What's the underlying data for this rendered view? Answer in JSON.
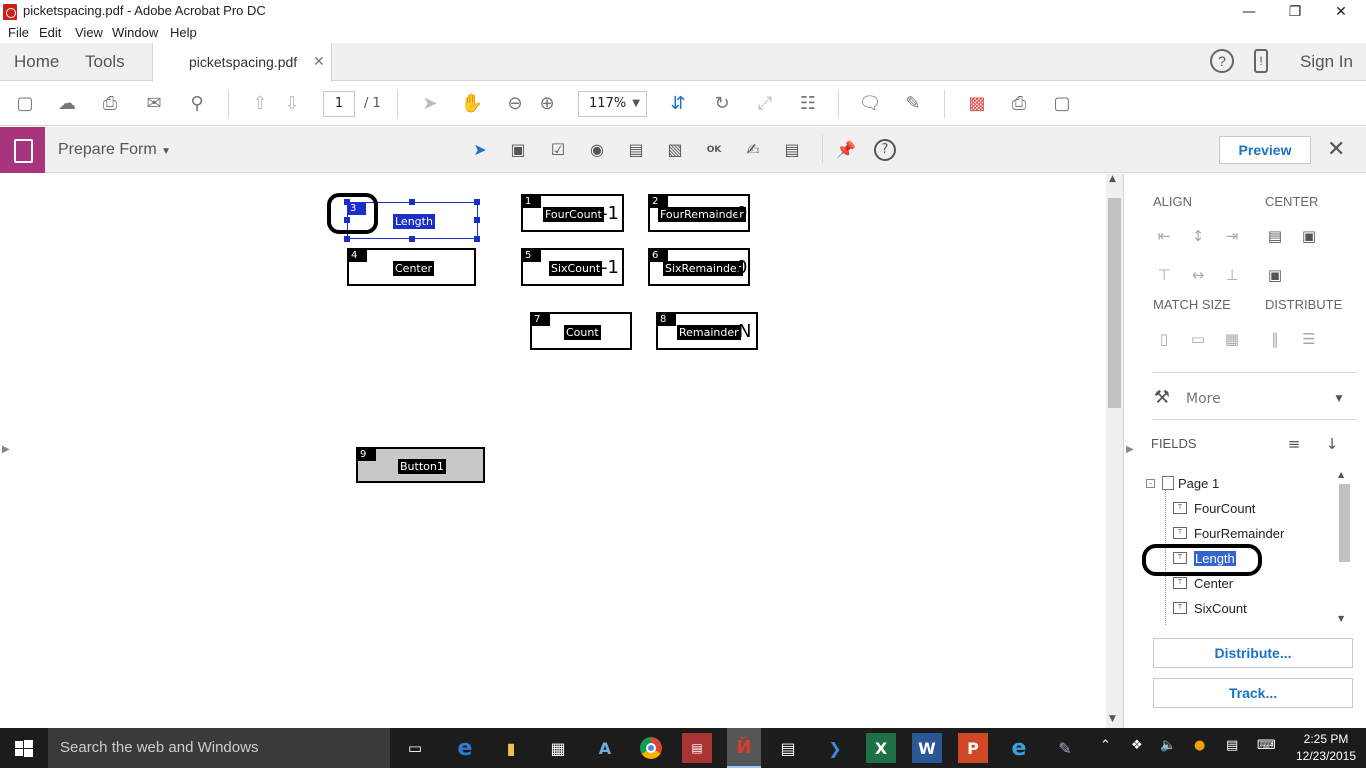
{
  "window": {
    "title": "picketspacing.pdf - Adobe Acrobat Pro DC"
  },
  "menu": {
    "file": "File",
    "edit": "Edit",
    "view": "View",
    "window": "Window",
    "help": "Help"
  },
  "tabs": {
    "home": "Home",
    "tools": "Tools",
    "document": "picketspacing.pdf",
    "sign_in": "Sign In"
  },
  "toolbar": {
    "page_current": "1",
    "page_total": "/ 1",
    "zoom": "117%"
  },
  "prepare_form": {
    "title": "Prepare Form",
    "preview": "Preview"
  },
  "fields_on_page": [
    {
      "num": "3",
      "name": "Length",
      "value": ""
    },
    {
      "num": "4",
      "name": "Center",
      "value": ""
    },
    {
      "num": "1",
      "name": "FourCount",
      "value": "-1"
    },
    {
      "num": "2",
      "name": "FourRemainder",
      "value": "0"
    },
    {
      "num": "5",
      "name": "SixCount",
      "value": "-1"
    },
    {
      "num": "6",
      "name": "SixRemainder",
      "value": "0"
    },
    {
      "num": "7",
      "name": "Count",
      "value": ""
    },
    {
      "num": "8",
      "name": "Remainder",
      "value": "N"
    },
    {
      "num": "9",
      "name": "Button1",
      "value": ""
    }
  ],
  "right_panel": {
    "align": "ALIGN",
    "center": "CENTER",
    "match_size": "MATCH SIZE",
    "distribute": "DISTRIBUTE",
    "more": "More",
    "fields_heading": "FIELDS",
    "tree": {
      "page": "Page 1",
      "items": [
        "FourCount",
        "FourRemainder",
        "Length",
        "Center",
        "SixCount"
      ],
      "selected": "Length"
    },
    "distribute_btn": "Distribute...",
    "track_btn": "Track..."
  },
  "taskbar": {
    "search": "Search the web and Windows",
    "time": "2:25 PM",
    "date": "12/23/2015"
  }
}
